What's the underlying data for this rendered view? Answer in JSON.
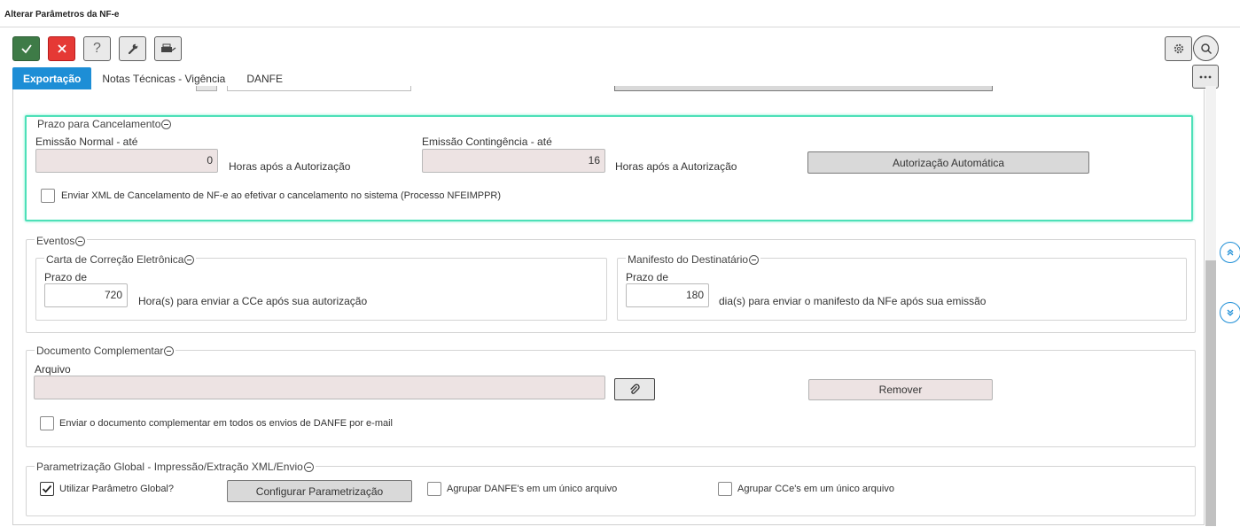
{
  "window": {
    "title": "Alterar Parâmetros da NF-e"
  },
  "toolbar": {
    "confirm": "confirm",
    "cancel": "cancel",
    "help": "?",
    "tools": "wrench",
    "print": "print"
  },
  "tabs": [
    {
      "label": "Exportação",
      "active": true
    },
    {
      "label": "Notas Técnicas - Vigência",
      "active": false
    },
    {
      "label": "DANFE",
      "active": false
    }
  ],
  "cancelamento": {
    "legend": "Prazo para Cancelamento",
    "normal_label": "Emissão Normal - até",
    "normal_value": "0",
    "normal_unit": "Horas após a Autorização",
    "contingencia_label": "Emissão Contingência - até",
    "contingencia_value": "16",
    "contingencia_unit": "Horas após a Autorização",
    "auto_button": "Autorização Automática",
    "xml_checkbox": "Enviar XML de Cancelamento de NF-e ao efetivar o cancelamento no sistema (Processo NFEIMPPR)",
    "xml_checked": false
  },
  "eventos": {
    "legend": "Eventos",
    "cce": {
      "legend": "Carta de Correção Eletrônica",
      "prazo_label": "Prazo de",
      "value": "720",
      "unit": "Hora(s) para enviar a CCe após sua autorização"
    },
    "manifesto": {
      "legend": "Manifesto do Destinatário",
      "prazo_label": "Prazo de",
      "value": "180",
      "unit": "dia(s) para enviar o manifesto da NFe após sua emissão"
    }
  },
  "documento": {
    "legend": "Documento Complementar",
    "arquivo_label": "Arquivo",
    "arquivo_value": "",
    "remover_button": "Remover",
    "checkbox": "Enviar o documento complementar em todos os envios de DANFE por e-mail",
    "checked": false
  },
  "global": {
    "legend": "Parametrização Global - Impressão/Extração XML/Envio",
    "usar_global": "Utilizar Parâmetro Global?",
    "usar_global_checked": true,
    "config_button": "Configurar Parametrização",
    "agrupar_danfe": "Agrupar DANFE's em um único arquivo",
    "agrupar_danfe_checked": false,
    "agrupar_cce": "Agrupar CCe's em um único arquivo",
    "agrupar_cce_checked": false
  },
  "colors": {
    "accent": "#1d8ed6",
    "highlight": "#4de0b8",
    "confirm": "#3e7b47",
    "cancel": "#e53935"
  }
}
